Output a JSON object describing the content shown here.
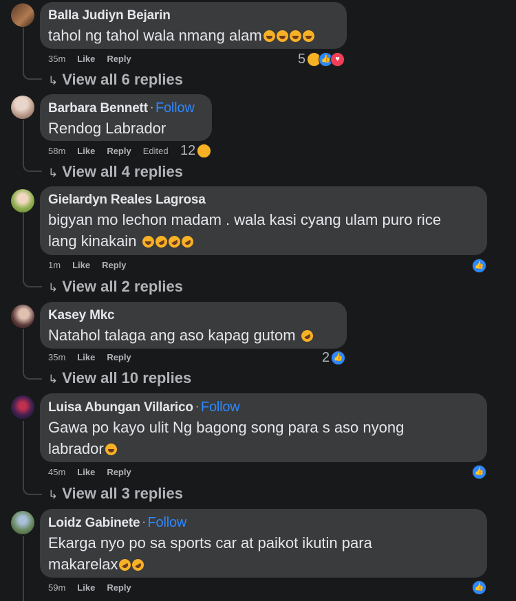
{
  "comments": [
    {
      "name": "Balla Judiyn Bejarin",
      "follow": "",
      "text": "tahol ng tahol wala nmang alam",
      "emoji": "😂😂😂😂",
      "time": "35m",
      "like": "Like",
      "reply": "Reply",
      "edited": "",
      "reaction_count": "5",
      "reactions": [
        "haha",
        "like",
        "love"
      ],
      "view_replies": "View all 6 replies"
    },
    {
      "name": "Barbara Bennett",
      "follow": "Follow",
      "text": "Rendog Labrador",
      "emoji": "",
      "time": "58m",
      "like": "Like",
      "reply": "Reply",
      "edited": "Edited",
      "reaction_count": "12",
      "reactions": [
        "haha"
      ],
      "view_replies": "View all 4 replies"
    },
    {
      "name": "Gielardyn Reales Lagrosa",
      "follow": "",
      "text_line1": "bigyan mo lechon madam . wala kasi cyang ulam puro rice",
      "text_line2": "lang kinakain",
      "emoji": "😂🤣🤣🤣",
      "time": "1m",
      "like": "Like",
      "reply": "Reply",
      "reaction_count": "",
      "reactions": [
        "like"
      ],
      "view_replies": "View all 2 replies"
    },
    {
      "name": "Kasey Mkc",
      "follow": "",
      "text": "Natahol talaga ang aso kapag gutom",
      "emoji": "🤣",
      "time": "35m",
      "like": "Like",
      "reply": "Reply",
      "reaction_count": "2",
      "reactions": [
        "like"
      ],
      "view_replies": "View all 10 replies"
    },
    {
      "name": "Luisa Abungan Villarico",
      "follow": "Follow",
      "text_line1": "Gawa po kayo ulit Ng bagong song para s aso nyong",
      "text_line2": "labrador",
      "emoji": "😂",
      "time": "45m",
      "like": "Like",
      "reply": "Reply",
      "reaction_count": "",
      "reactions": [
        "like"
      ],
      "view_replies": "View all 3 replies"
    },
    {
      "name": "Loidz Gabinete",
      "follow": "Follow",
      "text_line1": "Ekarga nyo po sa sports car at paikot ikutin para",
      "text_line2": "makarelax",
      "emoji": "🤣🤣",
      "time": "59m",
      "like": "Like",
      "reply": "Reply",
      "reaction_count": "",
      "reactions": [
        "like"
      ]
    }
  ],
  "colors": {
    "background": "#18191a",
    "bubble": "#3a3b3c",
    "follow_link": "#2d88ff",
    "secondary_text": "#b0b3b8"
  },
  "icons": [
    "reply-arrow-icon",
    "haha-reaction-icon",
    "like-reaction-icon",
    "love-reaction-icon"
  ]
}
